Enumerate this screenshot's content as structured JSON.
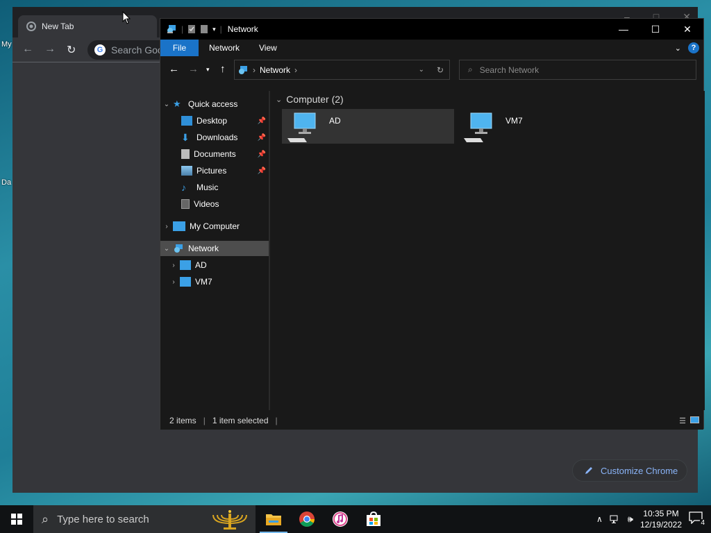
{
  "desktop": {
    "labels": [
      "My",
      "Da"
    ]
  },
  "chrome": {
    "tab_title": "New Tab",
    "omnibox_placeholder": "Search Goo",
    "customize_label": "Customize Chrome"
  },
  "explorer": {
    "title": "Network",
    "ribbon_tabs": [
      "File",
      "Network",
      "View"
    ],
    "help_label": "?",
    "address": {
      "crumb": "Network"
    },
    "search_placeholder": "Search Network",
    "nav": {
      "quick_access": "Quick access",
      "desktop": "Desktop",
      "downloads": "Downloads",
      "documents": "Documents",
      "pictures": "Pictures",
      "music": "Music",
      "videos": "Videos",
      "my_computer": "My Computer",
      "network": "Network",
      "ad": "AD",
      "vm7": "VM7"
    },
    "group_header": "Computer (2)",
    "items": [
      {
        "name": "AD",
        "selected": true
      },
      {
        "name": "VM7",
        "selected": false
      }
    ],
    "status": {
      "count": "2 items",
      "selection": "1 item selected"
    }
  },
  "taskbar": {
    "search_placeholder": "Type here to search",
    "time": "10:35 PM",
    "date": "12/19/2022",
    "notification_count": "4"
  },
  "colors": {
    "accent": "#1a73c8",
    "chrome_link": "#8ab4f8"
  }
}
